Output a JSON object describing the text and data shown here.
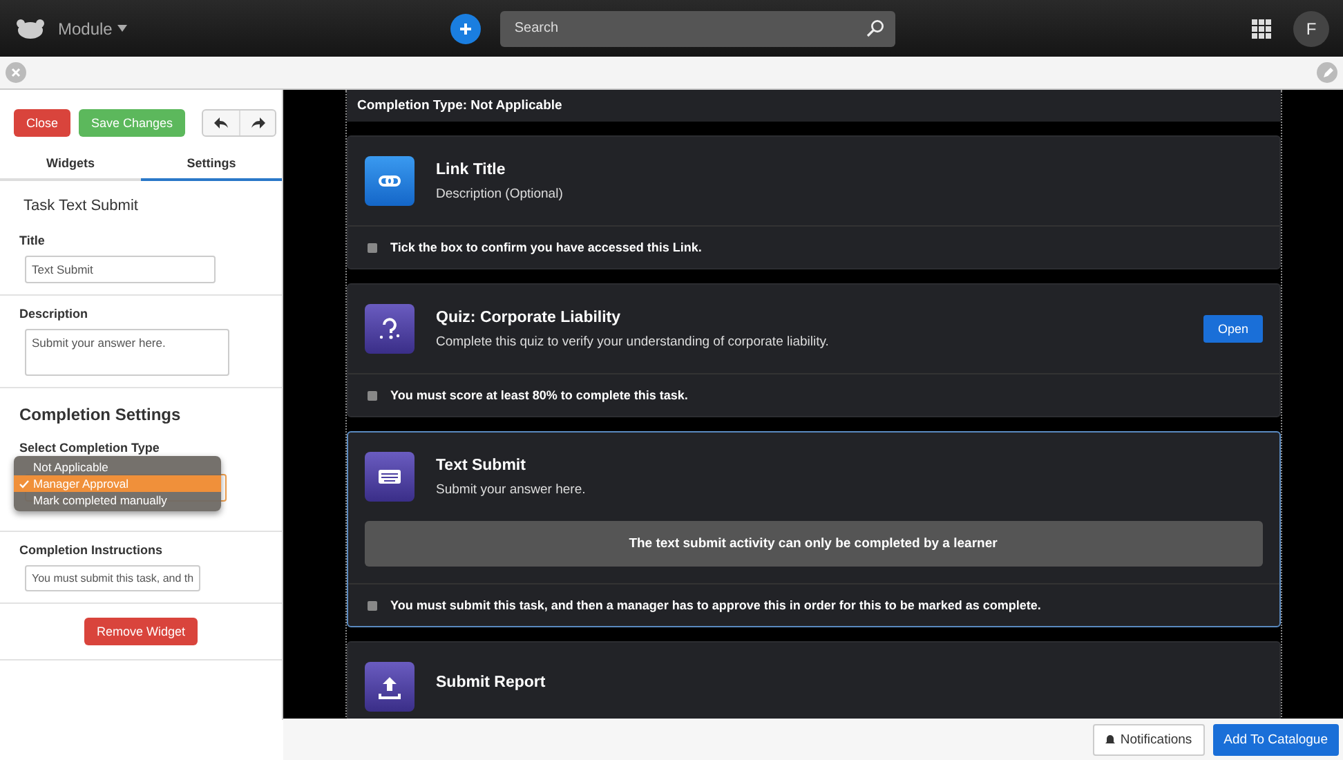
{
  "topbar": {
    "module": "Module",
    "search": {
      "placeholder": "Search"
    },
    "avatar": "F"
  },
  "panel": {
    "close": "Close",
    "save": "Save Changes",
    "tabs": [
      {
        "label": "Widgets",
        "selected": false
      },
      {
        "label": "Settings",
        "selected": true
      }
    ],
    "heading": "Task Text Submit",
    "title": {
      "label": "Title",
      "value": "Text Submit"
    },
    "description": {
      "label": "Description",
      "value": "Submit your answer here."
    },
    "completion": {
      "heading": "Completion Settings",
      "label": "Select Completion Type",
      "options": [
        {
          "label": "Not Applicable",
          "selected": false
        },
        {
          "label": "Manager Approval",
          "selected": true
        },
        {
          "label": "Mark completed manually",
          "selected": false
        }
      ]
    },
    "instructions": {
      "label": "Completion Instructions",
      "value": "You must submit this task, and th"
    },
    "remove": "Remove Widget"
  },
  "canvas": {
    "completion_type": "Completion Type: Not Applicable",
    "cards": [
      {
        "kind": "link",
        "title": "Link Title",
        "description": "Description (Optional)",
        "note": "Tick the box to confirm you have accessed this Link.",
        "checked": false,
        "selected": false
      },
      {
        "kind": "quiz",
        "title": "Quiz: Corporate Liability",
        "description": "Complete this quiz to verify your understanding of corporate liability.",
        "action": "Open",
        "note": "You must score at least 80% to complete this task.",
        "checked": false,
        "selected": false
      },
      {
        "kind": "text",
        "title": "Text Submit",
        "description": "Submit your answer here.",
        "notice": "The text submit activity can only be completed by a learner",
        "note": "You must submit this task, and then a manager has to approve this in order for this to be marked as complete.",
        "checked": false,
        "selected": true
      },
      {
        "kind": "report",
        "title": "Submit Report",
        "selected": false
      }
    ]
  },
  "footer": {
    "notifications": "Notifications",
    "add": "Add To Catalogue"
  }
}
